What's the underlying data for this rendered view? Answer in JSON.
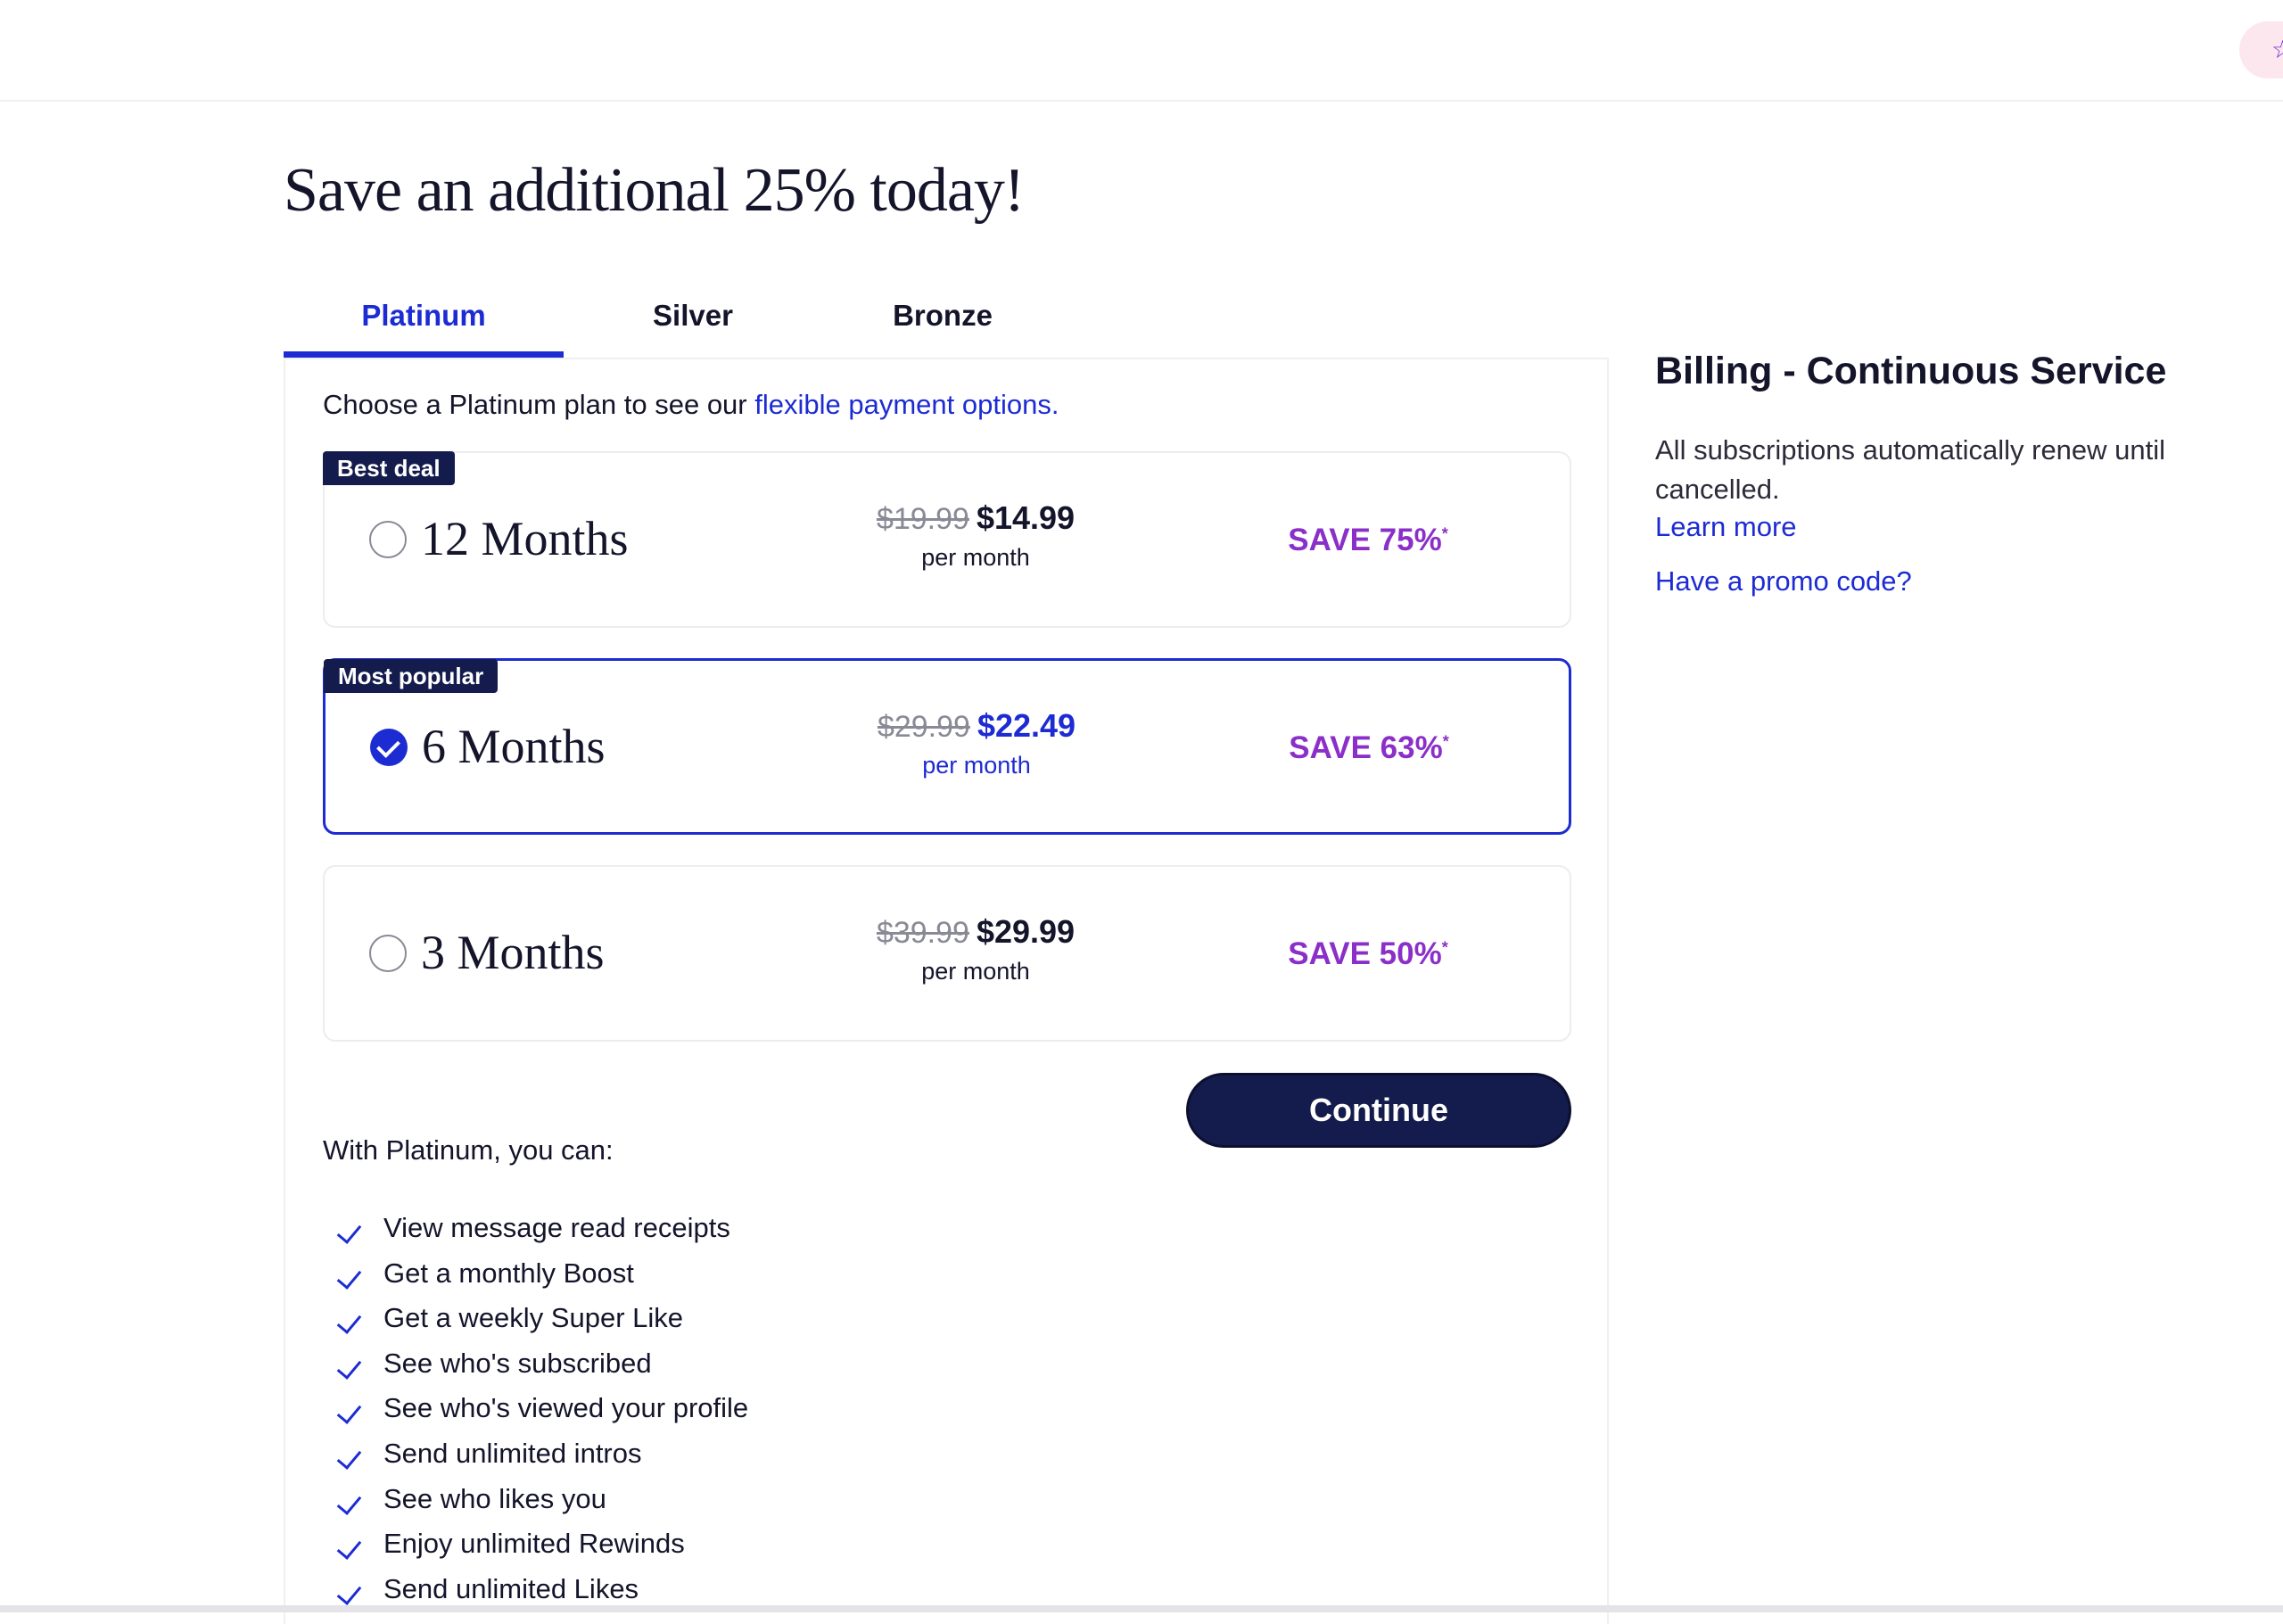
{
  "header": {
    "promo_icon": "star-icon"
  },
  "page": {
    "title": "Save an additional 25% today!"
  },
  "tabs": [
    {
      "label": "Platinum",
      "active": true
    },
    {
      "label": "Silver",
      "active": false
    },
    {
      "label": "Bronze",
      "active": false
    }
  ],
  "intro": {
    "text": "Choose a Platinum plan to see our ",
    "link": "flexible payment options."
  },
  "plans": [
    {
      "badge": "Best deal",
      "name": "12 Months",
      "old_price": "$19.99",
      "price": "$14.99",
      "per": "per month",
      "save": "SAVE 75%",
      "asterisk": "*",
      "selected": false
    },
    {
      "badge": "Most popular",
      "name": "6 Months",
      "old_price": "$29.99",
      "price": "$22.49",
      "per": "per month",
      "save": "SAVE 63%",
      "asterisk": "*",
      "selected": true
    },
    {
      "badge": "",
      "name": "3 Months",
      "old_price": "$39.99",
      "price": "$29.99",
      "per": "per month",
      "save": "SAVE 50%",
      "asterisk": "*",
      "selected": false
    }
  ],
  "continue_label": "Continue",
  "features": {
    "heading": "With Platinum, you can:",
    "items": [
      "View message read receipts",
      "Get a monthly Boost",
      "Get a weekly Super Like",
      "See who's subscribed",
      "See who's viewed your profile",
      "Send unlimited intros",
      "See who likes you",
      "Enjoy unlimited Rewinds",
      "Send unlimited Likes"
    ]
  },
  "billing": {
    "title": "Billing - Continuous Service",
    "text": "All subscriptions automatically renew until cancelled.",
    "learn_more": "Learn more",
    "promo": "Have a promo code?"
  },
  "colors": {
    "accent": "#1d2bd3",
    "navy": "#141b4d",
    "save": "#8b2fc9"
  }
}
